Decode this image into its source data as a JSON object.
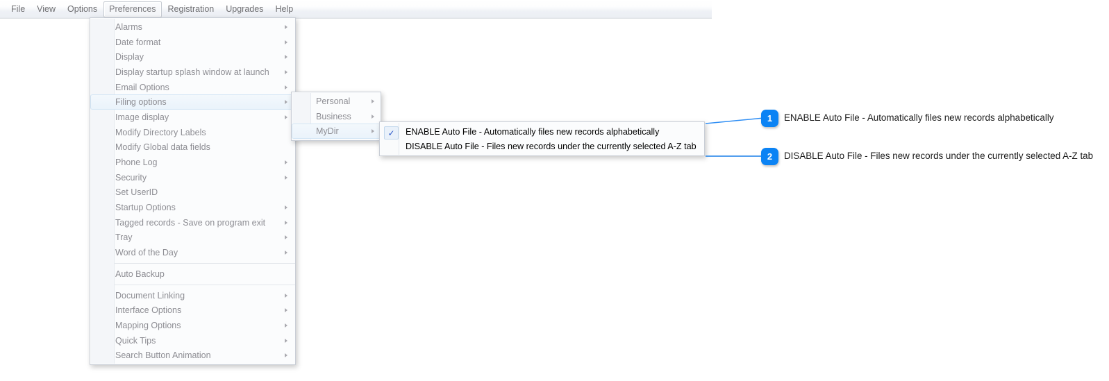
{
  "menubar": {
    "items": [
      {
        "label": "File",
        "active": false
      },
      {
        "label": "View",
        "active": false
      },
      {
        "label": "Options",
        "active": false
      },
      {
        "label": "Preferences",
        "active": true
      },
      {
        "label": "Registration",
        "active": false
      },
      {
        "label": "Upgrades",
        "active": false
      },
      {
        "label": "Help",
        "active": false
      }
    ]
  },
  "preferences_menu": {
    "items": [
      {
        "label": "Alarms",
        "submenu": true
      },
      {
        "label": "Date format",
        "submenu": true
      },
      {
        "label": "Display",
        "submenu": true
      },
      {
        "label": "Display startup splash window at launch",
        "submenu": true
      },
      {
        "label": "Email Options",
        "submenu": true
      },
      {
        "label": "Filing options",
        "submenu": true,
        "selected": true
      },
      {
        "label": "Image display",
        "submenu": true
      },
      {
        "label": "Modify Directory Labels",
        "submenu": false
      },
      {
        "label": "Modify Global data fields",
        "submenu": false
      },
      {
        "label": "Phone Log",
        "submenu": true
      },
      {
        "label": "Security",
        "submenu": true
      },
      {
        "label": "Set UserID",
        "submenu": false
      },
      {
        "label": "Startup Options",
        "submenu": true
      },
      {
        "label": "Tagged records - Save on program exit",
        "submenu": true
      },
      {
        "label": "Tray",
        "submenu": true
      },
      {
        "label": "Word of the Day",
        "submenu": true
      },
      {
        "separator": true
      },
      {
        "label": "Auto Backup",
        "submenu": false
      },
      {
        "separator": true
      },
      {
        "label": "Document Linking",
        "submenu": true
      },
      {
        "label": "Interface Options",
        "submenu": true
      },
      {
        "label": "Mapping Options",
        "submenu": true
      },
      {
        "label": "Quick Tips",
        "submenu": true
      },
      {
        "label": "Search Button Animation",
        "submenu": true
      }
    ]
  },
  "filing_options_menu": {
    "items": [
      {
        "label": "Personal",
        "submenu": true
      },
      {
        "label": "Business",
        "submenu": true
      },
      {
        "label": "MyDir",
        "submenu": true,
        "selected": true
      }
    ]
  },
  "mydir_menu": {
    "items": [
      {
        "label": "ENABLE Auto File - Automatically files new records alphabetically",
        "checked": true,
        "check_glyph": "✓"
      },
      {
        "label": "DISABLE Auto File - Files new records under the currently selected A-Z tab",
        "checked": false
      }
    ]
  },
  "annotations": {
    "accent_color": "#0b83f4",
    "items": [
      {
        "number": "1",
        "text": "ENABLE Auto File - Automatically files new records alphabetically"
      },
      {
        "number": "2",
        "text": "DISABLE Auto File - Files new records under the currently selected A-Z tab"
      }
    ]
  }
}
